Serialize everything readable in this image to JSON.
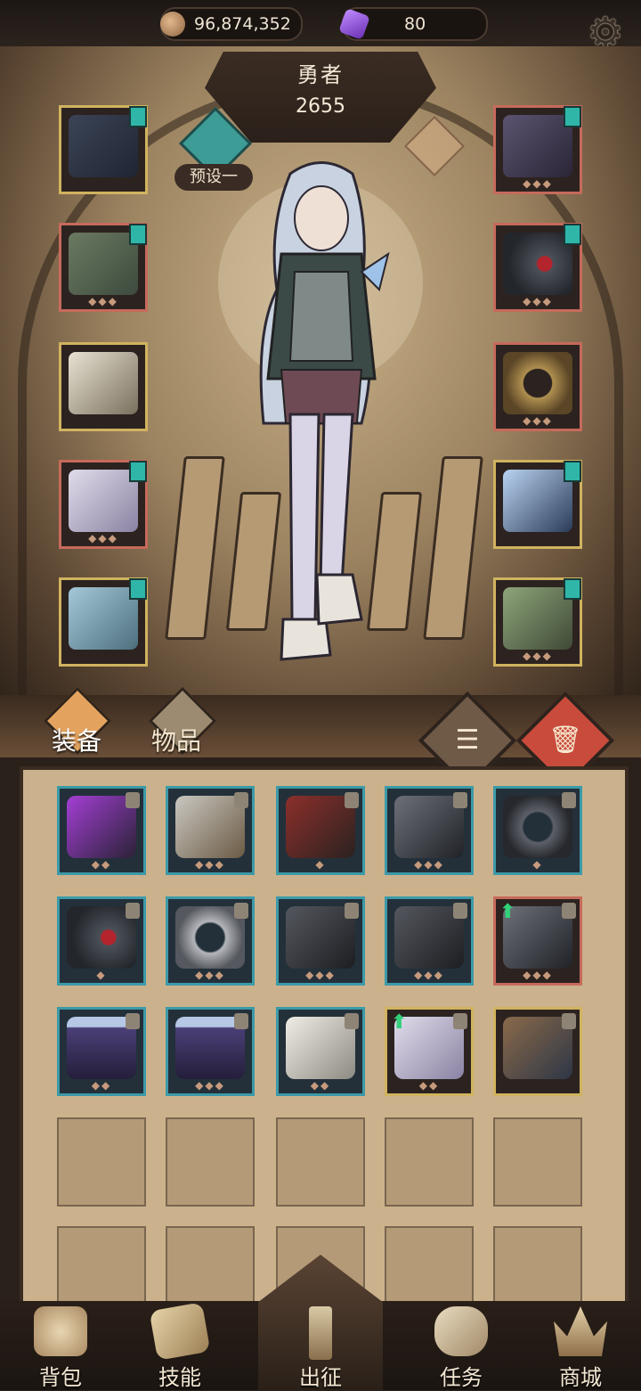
{
  "resources": {
    "coins": {
      "icon": "coin-icon",
      "value": "96,874,352",
      "color": "#b98a5e"
    },
    "gems": {
      "icon": "crystal-icon",
      "value": "80",
      "color": "#8b55c9"
    }
  },
  "hero": {
    "name": "勇者",
    "power": "2655"
  },
  "preset": {
    "label": "预设一"
  },
  "tabs": {
    "equip": "装备",
    "items": "物品"
  },
  "equipped_left": [
    {
      "item": "star-helmet-icon",
      "frame": "gold",
      "badge": true
    },
    {
      "item": "fur-armor-icon",
      "frame": "red",
      "badge": true
    },
    {
      "item": "gauntlet-icon",
      "frame": "gold",
      "badge": false
    },
    {
      "item": "pants-icon",
      "frame": "red",
      "badge": true
    },
    {
      "item": "boots-icon",
      "frame": "gold",
      "badge": true
    }
  ],
  "equipped_right": [
    {
      "item": "amulet-icon",
      "frame": "red",
      "badge": true
    },
    {
      "item": "red-gem-ring-icon",
      "frame": "red",
      "badge": true
    },
    {
      "item": "gold-ring-icon",
      "frame": "red",
      "badge": false
    },
    {
      "item": "crystal-sword-icon",
      "frame": "gold",
      "badge": true
    },
    {
      "item": "moss-cloak-icon",
      "frame": "gold",
      "badge": true
    }
  ],
  "inventory_rows": [
    [
      "purple-ring-icon",
      "bandage-glove-icon",
      "red-glove-icon",
      "claw-gauntlet-icon",
      "rune-ring-icon"
    ],
    [
      "red-gem-ring-icon",
      "silver-ring-icon",
      "black-boots-icon",
      "black-boots-icon",
      "claw-gauntlet-icon"
    ],
    [
      "moon-skirt-icon",
      "moon-skirt-icon",
      "white-pants-icon",
      "pants-icon",
      "spiked-boots-icon"
    ]
  ],
  "nav": [
    {
      "label": "背包",
      "icon": "backpack-icon"
    },
    {
      "label": "技能",
      "icon": "skillbook-icon"
    },
    {
      "label": "出征",
      "icon": "sword-icon"
    },
    {
      "label": "任务",
      "icon": "scroll-icon"
    },
    {
      "label": "商城",
      "icon": "crown-shop-icon"
    }
  ],
  "colors": {
    "teal_frame": "#3c9aa8",
    "gold_frame": "#d0b35f",
    "red_frame": "#c66a5b",
    "accent_teal": "#3e9c97"
  }
}
